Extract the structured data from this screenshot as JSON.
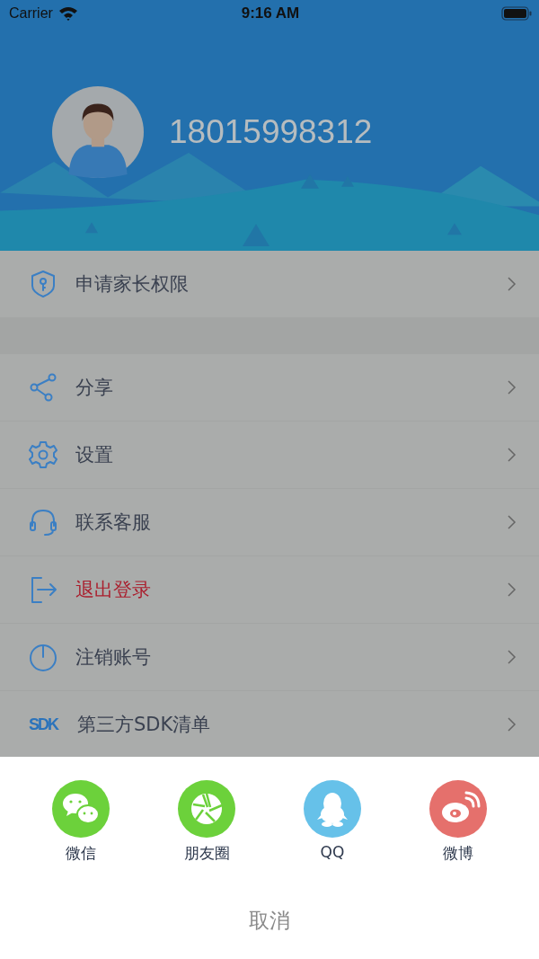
{
  "status_bar": {
    "carrier": "Carrier",
    "time": "9:16 AM"
  },
  "profile": {
    "phone": "18015998312"
  },
  "menu_groups": [
    {
      "items": [
        {
          "label": "申请家长权限",
          "destructive": false
        }
      ]
    },
    {
      "items": [
        {
          "label": "分享",
          "destructive": false
        },
        {
          "label": "设置",
          "destructive": false
        },
        {
          "label": "联系客服",
          "destructive": false
        },
        {
          "label": "退出登录",
          "destructive": true
        },
        {
          "label": "注销账号",
          "destructive": false
        },
        {
          "label": "第三方SDK清单",
          "destructive": false,
          "badge": "SDK"
        }
      ]
    }
  ],
  "share_sheet": {
    "targets": [
      {
        "label": "微信",
        "color": "#6cd13b"
      },
      {
        "label": "朋友圈",
        "color": "#6cd13b"
      },
      {
        "label": "QQ",
        "color": "#66c1e9"
      },
      {
        "label": "微博",
        "color": "#e5706c"
      }
    ],
    "cancel": "取消"
  }
}
